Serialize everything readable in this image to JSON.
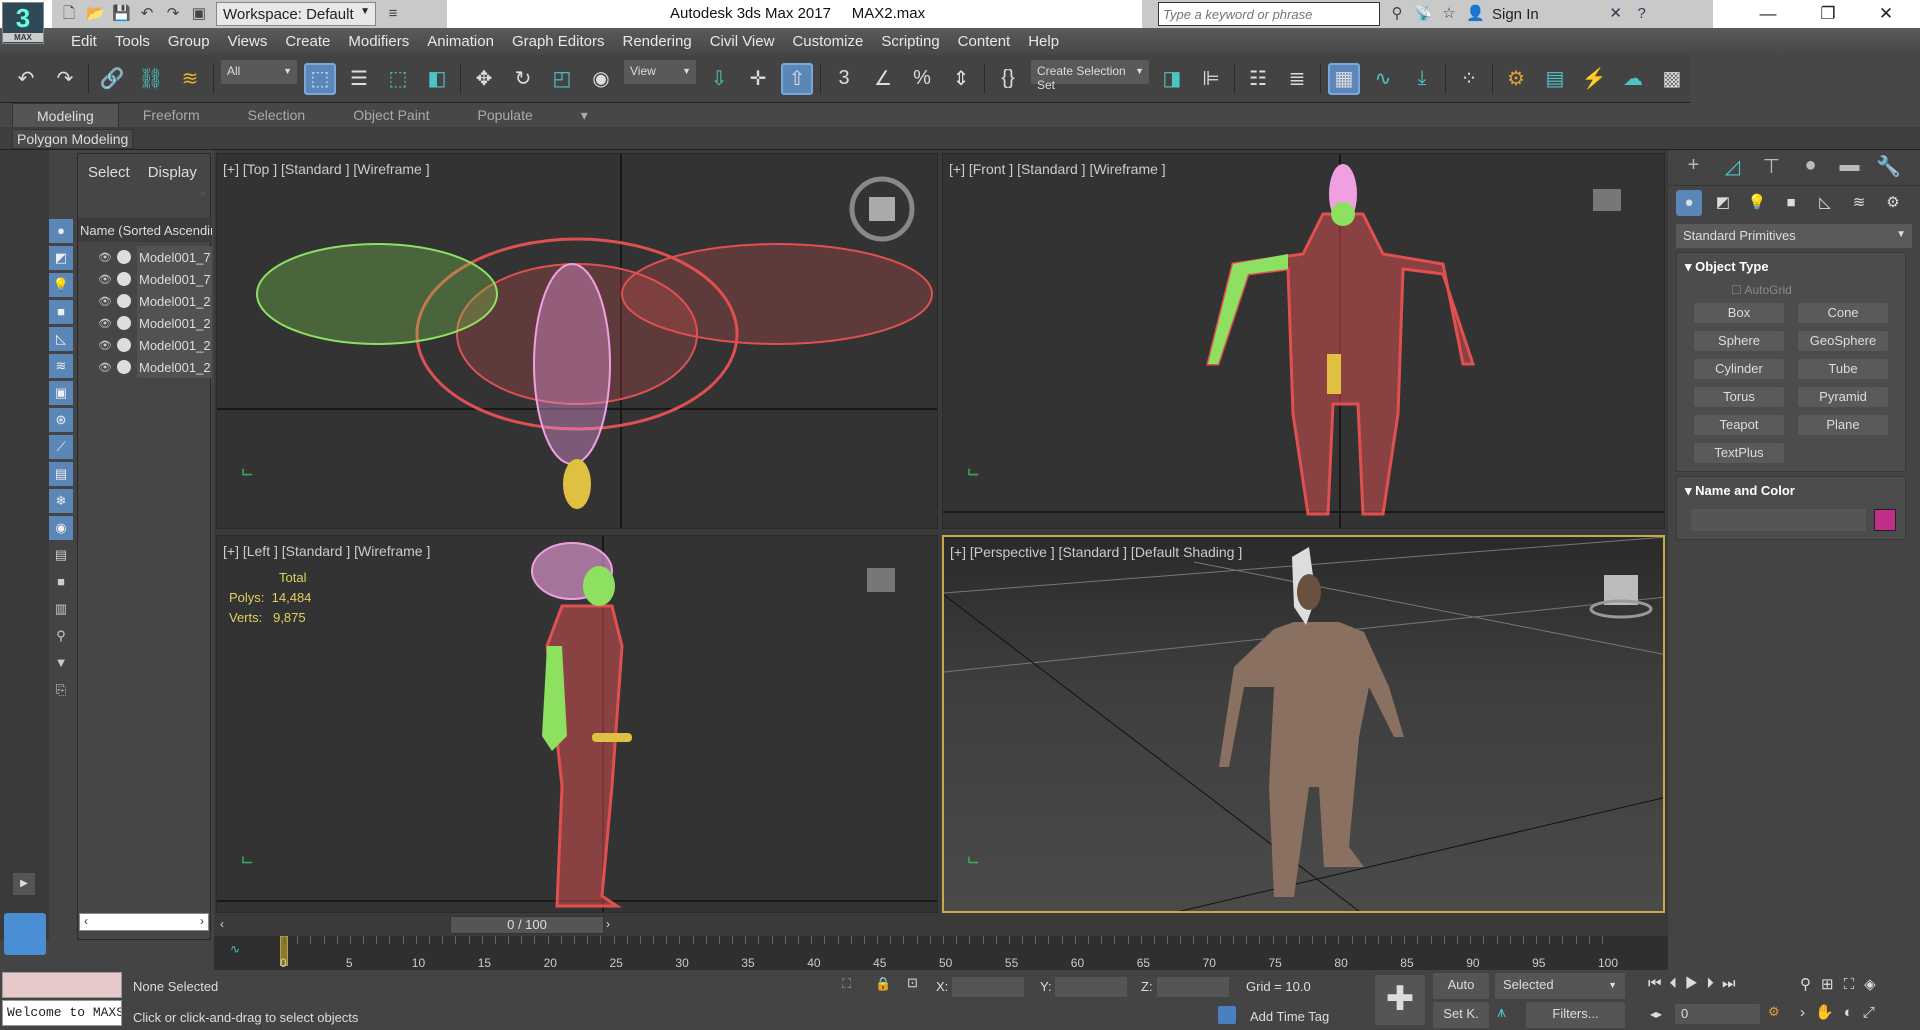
{
  "app": {
    "logo": "3",
    "logo_sub": "MAX",
    "title": "Autodesk 3ds Max 2017     MAX2.max",
    "workspace": "Workspace: Default",
    "search_placeholder": "Type a keyword or phrase",
    "sign_in": "Sign In"
  },
  "menu": [
    "Edit",
    "Tools",
    "Group",
    "Views",
    "Create",
    "Modifiers",
    "Animation",
    "Graph Editors",
    "Rendering",
    "Civil View",
    "Customize",
    "Scripting",
    "Content",
    "Help"
  ],
  "toolbar": {
    "filter": "All",
    "ref_coord": "View",
    "selection_set": "Create Selection Set"
  },
  "ribbon": {
    "tabs": [
      "Modeling",
      "Freeform",
      "Selection",
      "Object Paint",
      "Populate"
    ],
    "panel": "Polygon Modeling"
  },
  "explorer": {
    "tabs": [
      "Select",
      "Display"
    ],
    "column": "Name (Sorted Ascending)",
    "items": [
      "Model001_7",
      "Model001_7",
      "Model001_2",
      "Model001_2",
      "Model001_2",
      "Model001_2"
    ]
  },
  "viewports": {
    "top": "[+] [Top ] [Standard ] [Wireframe ]",
    "front": "[+] [Front ] [Standard ] [Wireframe ]",
    "left": "[+] [Left ] [Standard ] [Wireframe ]",
    "perspective": "[+] [Perspective ] [Standard ] [Default Shading ]",
    "stats": {
      "header": "Total",
      "polys_label": "Polys:",
      "polys": "14,484",
      "verts_label": "Verts:",
      "verts": "9,875"
    }
  },
  "command_panel": {
    "category": "Standard Primitives",
    "object_type": "Object Type",
    "autogrid": "AutoGrid",
    "primitives": [
      "Box",
      "Cone",
      "Sphere",
      "GeoSphere",
      "Cylinder",
      "Tube",
      "Torus",
      "Pyramid",
      "Teapot",
      "Plane",
      "TextPlus"
    ],
    "name_and_color": "Name and Color",
    "object_color": "#c0308a"
  },
  "timeline": {
    "slider": "0 / 100",
    "ticks": [
      0,
      5,
      10,
      15,
      20,
      25,
      30,
      35,
      40,
      45,
      50,
      55,
      60,
      65,
      70,
      75,
      80,
      85,
      90,
      95,
      100
    ]
  },
  "status": {
    "selection": "None Selected",
    "prompt": "Click or click-and-drag to select objects",
    "maxscript": "Welcome to MAXScript.",
    "x_label": "X:",
    "y_label": "Y:",
    "z_label": "Z:",
    "grid": "Grid = 10.0",
    "add_time_tag": "Add Time Tag",
    "auto": "Auto",
    "set_key": "Set K.",
    "key_filter": "Selected",
    "filters": "Filters...",
    "frame": "0"
  }
}
